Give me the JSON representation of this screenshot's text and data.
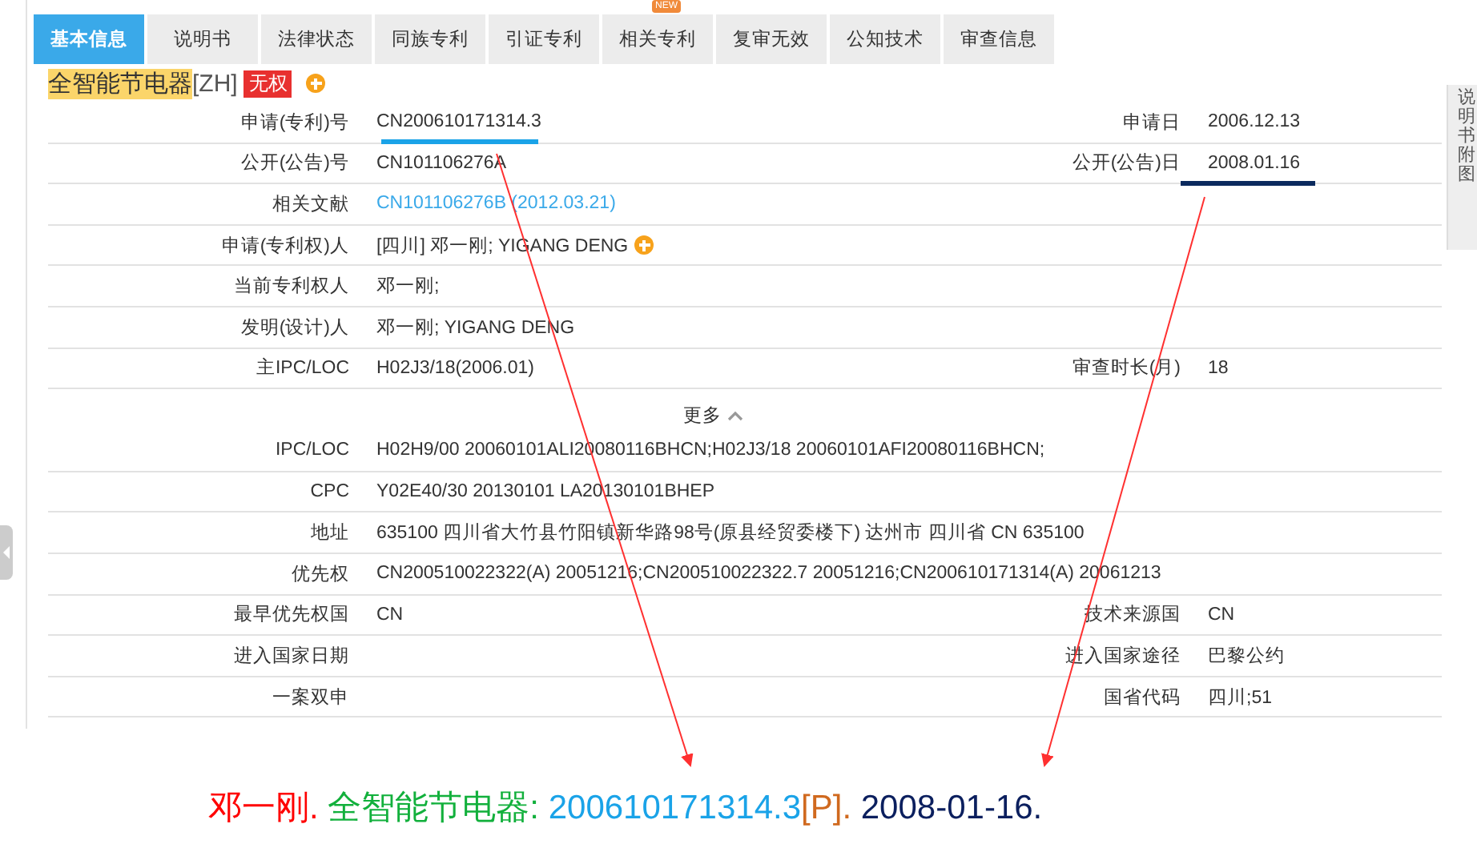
{
  "tabs": [
    {
      "label": "基本信息",
      "selected": true
    },
    {
      "label": "说明书",
      "selected": false
    },
    {
      "label": "法律状态",
      "selected": false
    },
    {
      "label": "同族专利",
      "selected": false
    },
    {
      "label": "引证专利",
      "selected": false
    },
    {
      "label": "相关专利",
      "selected": false,
      "badge": "NEW"
    },
    {
      "label": "复审无效",
      "selected": false
    },
    {
      "label": "公知技术",
      "selected": false
    },
    {
      "label": "审查信息",
      "selected": false
    }
  ],
  "patent": {
    "title": "全智能节电器",
    "lang": "[ZH]",
    "status": "无权"
  },
  "rows": [
    {
      "label": "申请(专利)号",
      "value": "CN200610171314.3",
      "link": false,
      "plus": false,
      "underlined": true,
      "right_label": "申请日",
      "right_value": "2006.12.13",
      "right_underlined": false
    },
    {
      "label": "公开(公告)号",
      "value": "CN101106276A",
      "link": false,
      "plus": false,
      "underlined": false,
      "right_label": "公开(公告)日",
      "right_value": "2008.01.16",
      "right_underlined": true
    },
    {
      "label": "相关文献",
      "value": "CN101106276B (2012.03.21)",
      "link": true,
      "plus": false,
      "underlined": false,
      "right_underlined": false
    },
    {
      "label": "申请(专利权)人",
      "value": "[四川]  邓一刚; YIGANG DENG",
      "link": false,
      "plus": true,
      "underlined": false,
      "right_underlined": false
    },
    {
      "label": "当前专利权人",
      "value": "邓一刚;",
      "link": false,
      "plus": false,
      "underlined": false,
      "right_underlined": false
    },
    {
      "label": "发明(设计)人",
      "value": "邓一刚; YIGANG DENG",
      "link": false,
      "plus": false,
      "underlined": false,
      "right_underlined": false
    },
    {
      "label": "主IPC/LOC",
      "value": "H02J3/18(2006.01)",
      "link": false,
      "plus": false,
      "underlined": false,
      "right_label": "审查时长(月)",
      "right_value": "18",
      "right_underlined": false
    }
  ],
  "more_label": "更多",
  "more_rows": [
    {
      "label": "IPC/LOC",
      "value": "H02H9/00 20060101ALI20080116BHCN;H02J3/18 20060101AFI20080116BHCN;"
    },
    {
      "label": "CPC",
      "value": "Y02E40/30 20130101 LA20130101BHEP"
    },
    {
      "label": "地址",
      "value": "635100 四川省大竹县竹阳镇新华路98号(原县经贸委楼下) 达州市 四川省 CN 635100"
    },
    {
      "label": "优先权",
      "value": "CN200510022322(A) 20051216;CN200510022322.7 20051216;CN200610171314(A) 20061213"
    },
    {
      "label": "最早优先权国",
      "value": "CN",
      "right_label": "技术来源国",
      "right_value": "CN"
    },
    {
      "label": "进入国家日期",
      "right_label": "进入国家途径",
      "right_value": "巴黎公约"
    },
    {
      "label": "一案双申",
      "right_label": "国省代码",
      "right_value": "四川;51"
    }
  ],
  "side_panel": "说明书附图",
  "citation": [
    {
      "text": "邓一刚. ",
      "color": "#ff0000"
    },
    {
      "text": "全智能节电器: ",
      "color": "#12b03c"
    },
    {
      "text": "200610171314.3",
      "color": "#1aa3e8"
    },
    {
      "text": "[P]. ",
      "color": "#d0691e"
    },
    {
      "text": "2008-01-16.",
      "color": "#0b1f5e"
    }
  ]
}
